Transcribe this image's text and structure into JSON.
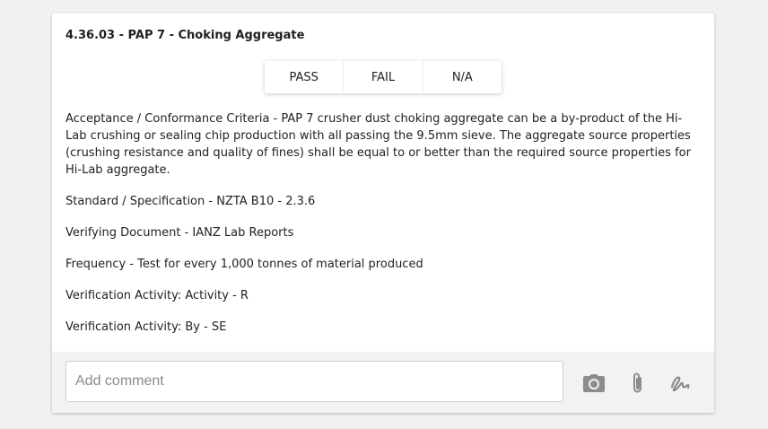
{
  "card": {
    "title": "4.36.03 - PAP 7 - Choking Aggregate",
    "choices": [
      "PASS",
      "FAIL",
      "N/A"
    ],
    "details": [
      "Acceptance / Conformance Criteria - PAP 7 crusher dust choking aggregate can be a by-product of the Hi-Lab crushing or sealing chip production with all passing the 9.5mm sieve. The aggregate source properties (crushing resistance and quality of fines) shall be equal to or better than the required source properties for Hi-Lab aggregate.",
      "Standard / Specification - NZTA B10 - 2.3.6",
      "Verifying Document - IANZ Lab Reports",
      "Frequency - Test for every 1,000 tonnes of material produced",
      "Verification Activity: Activity - R",
      "Verification Activity: By - SE"
    ]
  },
  "footer": {
    "comment_placeholder": "Add comment",
    "comment_value": "",
    "icons": [
      "camera-icon",
      "paperclip-icon",
      "signature-icon"
    ],
    "icon_color": "#8c8c8c"
  }
}
